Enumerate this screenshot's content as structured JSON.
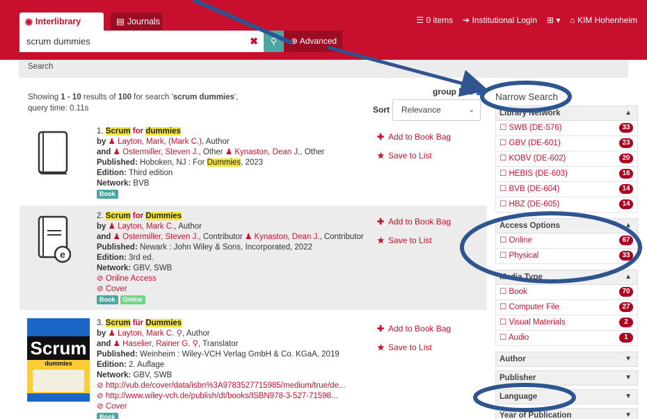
{
  "header": {
    "tabs": [
      {
        "label": "Interlibrary Loan",
        "active": true
      },
      {
        "label": "Journals",
        "active": false
      }
    ],
    "links": {
      "items": "0 items",
      "login": "Institutional Login",
      "user": "KIM Hohenheim"
    },
    "search": {
      "value": "scrum dummies",
      "advanced": "Advanced"
    }
  },
  "breadcrumb": "Search",
  "summary": {
    "prefix": "Showing ",
    "range": "1 - 10",
    "middle": " results of ",
    "total": "100",
    "for": " for search '",
    "query": "scrum dummies",
    "suffix": "',",
    "time": "query time: 0.11s"
  },
  "group_hits": "group hits",
  "sort": {
    "label": "Sort",
    "value": "Relevance"
  },
  "actions": {
    "add": "Add to Book Bag",
    "save": "Save to List"
  },
  "results": [
    {
      "num": "1.",
      "title_hl1": "Scrum",
      "title_mid": " for ",
      "title_hl2": "dummies",
      "by_name": "Layton, Mark, (Mark C.)",
      "by_role": ", Author",
      "and_1_name": "Ostermiller, Steven J.",
      "and_1_role": ", Other ",
      "and_2_name": "Kynaston, Dean J.",
      "and_2_role": ", Other",
      "published_pre": "Hoboken, NJ : For ",
      "published_hl": "Dummies",
      "published_post": ", 2023",
      "edition": "Third edition",
      "network": "BVB",
      "badges": [
        "Book"
      ]
    },
    {
      "num": "2.",
      "title_hl1": "Scrum",
      "title_mid": " for ",
      "title_hl2": "Dummies",
      "by_name": "Layton, Mark C.",
      "by_role": ", Author",
      "and_1_name": "Ostermiller, Steven J.",
      "and_1_role": ", Contributor ",
      "and_2_name": "Kynaston, Dean J.",
      "and_2_role": ", Contributor",
      "published": "Newark : John Wiley & Sons, Incorporated, 2022",
      "edition": "3rd ed.",
      "network": "GBV, SWB",
      "link1": "Online Access",
      "link2": "Cover",
      "badges": [
        "Book",
        "Online"
      ]
    },
    {
      "num": "3.",
      "title_hl1": "Scrum",
      "title_mid": " für ",
      "title_hl2": "Dummies",
      "by_name": "Layton, Mark C.",
      "by_role": ", Author",
      "and_1_name": "Haselier, Rainer G.",
      "and_1_role": ", Translator",
      "published": "Weinheim : Wiley-VCH Verlag GmbH & Co. KGaA, 2019",
      "edition": "2. Auflage",
      "network": "GBV, SWB",
      "link1": "http://vub.de/cover/data/isbn%3A9783527715985/medium/true/de...",
      "link2": "http://www.wiley-vch.de/publish/dt/books/ISBN978-3-527-71598...",
      "link3": "Cover",
      "badges": [
        "Book"
      ],
      "cover": {
        "word": "Scrum",
        "sub": "dummies"
      }
    }
  ],
  "labels": {
    "by": "by ",
    "and": "and ",
    "published": "Published: ",
    "edition": "Edition: ",
    "network": "Network: "
  },
  "sidebar": {
    "title": "Narrow Search",
    "network": {
      "head": "Library Network",
      "items": [
        {
          "label": "SWB (DE-576)",
          "count": "33"
        },
        {
          "label": "GBV (DE-601)",
          "count": "23"
        },
        {
          "label": "KOBV (DE-602)",
          "count": "20"
        },
        {
          "label": "HEBIS (DE-603)",
          "count": "16"
        },
        {
          "label": "BVB (DE-604)",
          "count": "14"
        },
        {
          "label": "HBZ (DE-605)",
          "count": "14"
        }
      ]
    },
    "access": {
      "head": "Access Options",
      "items": [
        {
          "label": "Online",
          "count": "67"
        },
        {
          "label": "Physical",
          "count": "33"
        }
      ]
    },
    "media": {
      "head": "Media Type",
      "items": [
        {
          "label": "Book",
          "count": "70"
        },
        {
          "label": "Computer File",
          "count": "27"
        },
        {
          "label": "Visual Materials",
          "count": "2"
        },
        {
          "label": "Audio",
          "count": "1"
        }
      ]
    },
    "collapsed": [
      "Author",
      "Publisher",
      "Language",
      "Year of Publication"
    ]
  },
  "colors": {
    "brand": "#c8102e",
    "annotation": "#2e5590"
  }
}
